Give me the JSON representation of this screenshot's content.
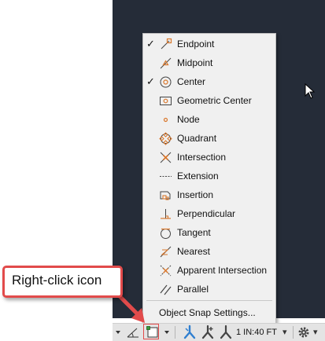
{
  "osnap_menu": {
    "items": [
      {
        "label": "Endpoint",
        "checked": true,
        "icon": "endpoint-icon"
      },
      {
        "label": "Midpoint",
        "checked": false,
        "icon": "midpoint-icon"
      },
      {
        "label": "Center",
        "checked": true,
        "icon": "center-icon"
      },
      {
        "label": "Geometric Center",
        "checked": false,
        "icon": "geometric-center-icon"
      },
      {
        "label": "Node",
        "checked": false,
        "icon": "node-icon"
      },
      {
        "label": "Quadrant",
        "checked": false,
        "icon": "quadrant-icon"
      },
      {
        "label": "Intersection",
        "checked": false,
        "icon": "intersection-icon"
      },
      {
        "label": "Extension",
        "checked": false,
        "icon": "extension-icon"
      },
      {
        "label": "Insertion",
        "checked": false,
        "icon": "insertion-icon"
      },
      {
        "label": "Perpendicular",
        "checked": false,
        "icon": "perpendicular-icon"
      },
      {
        "label": "Tangent",
        "checked": false,
        "icon": "tangent-icon"
      },
      {
        "label": "Nearest",
        "checked": false,
        "icon": "nearest-icon"
      },
      {
        "label": "Apparent Intersection",
        "checked": false,
        "icon": "apparent-intersection-icon"
      },
      {
        "label": "Parallel",
        "checked": false,
        "icon": "parallel-icon"
      }
    ],
    "checkmark": "✓",
    "settings_label": "Object Snap Settings..."
  },
  "status_bar": {
    "scale_label": "1 IN:40 FT",
    "dropdown_glyph": "▾",
    "icons": [
      "polar-tracking-icon",
      "object-snap-icon",
      "annotation-visibility-icon",
      "auto-scale-icon",
      "annotation-scale-icon",
      "workspace-gear-icon"
    ]
  },
  "callout": {
    "text": "Right-click icon"
  },
  "colors": {
    "canvas_bg": "#252c38",
    "menu_bg": "#f0f0f0",
    "snap_icon_orange": "#d9782d",
    "callout_red": "#e24b4b",
    "active_blue": "#2f7fd0"
  }
}
